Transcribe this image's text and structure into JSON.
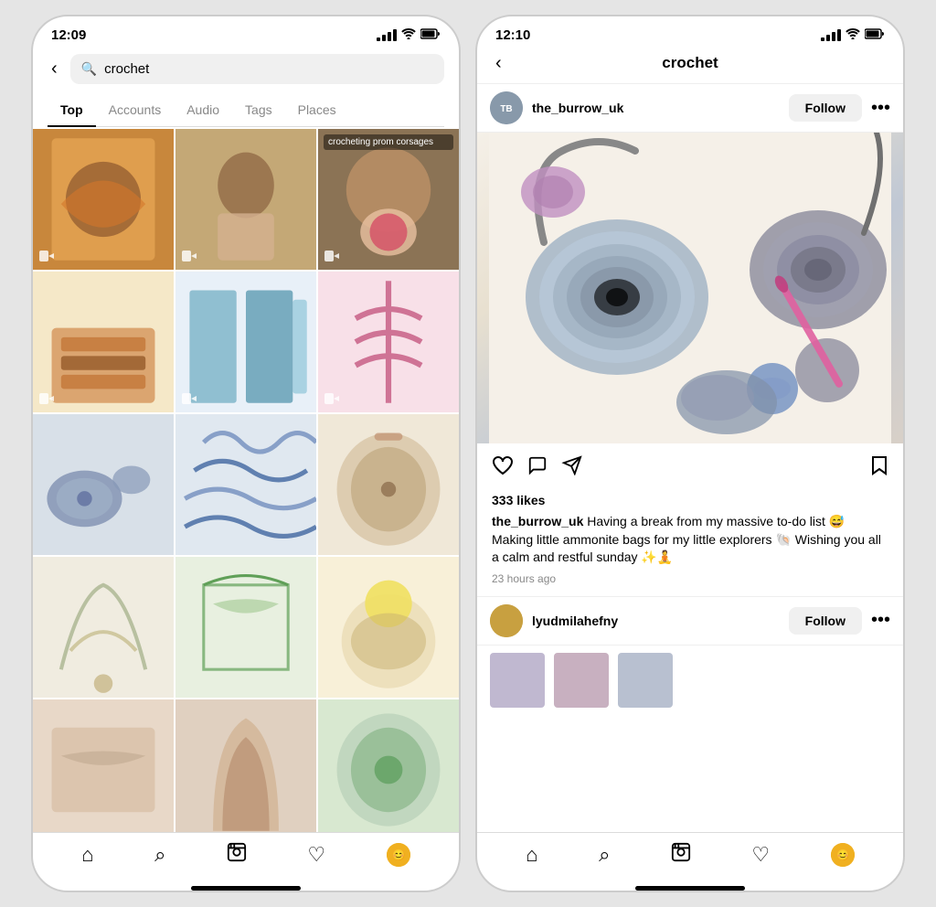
{
  "left_phone": {
    "status": {
      "time": "12:09",
      "location_icon": "▲"
    },
    "search": {
      "back_label": "‹",
      "search_placeholder": "crochet",
      "search_query": "crochet"
    },
    "tabs": [
      {
        "label": "Top",
        "active": true
      },
      {
        "label": "Accounts",
        "active": false
      },
      {
        "label": "Audio",
        "active": false
      },
      {
        "label": "Tags",
        "active": false
      },
      {
        "label": "Places",
        "active": false
      }
    ],
    "grid_items": [
      {
        "id": 1,
        "has_video": true,
        "class": "gi-1"
      },
      {
        "id": 2,
        "has_video": true,
        "class": "gi-2"
      },
      {
        "id": 3,
        "has_video": true,
        "class": "gi-3",
        "overlay": "crocheting prom corsages"
      },
      {
        "id": 4,
        "has_video": true,
        "class": "gi-4"
      },
      {
        "id": 5,
        "has_video": true,
        "class": "gi-5"
      },
      {
        "id": 6,
        "has_video": true,
        "class": "gi-6"
      },
      {
        "id": 7,
        "has_video": false,
        "class": "gi-7"
      },
      {
        "id": 8,
        "has_video": false,
        "class": "gi-8"
      },
      {
        "id": 9,
        "has_video": false,
        "class": "gi-9"
      },
      {
        "id": 10,
        "has_video": false,
        "class": "gi-10"
      },
      {
        "id": 11,
        "has_video": false,
        "class": "gi-11"
      },
      {
        "id": 12,
        "has_video": false,
        "class": "gi-12"
      },
      {
        "id": 13,
        "has_video": false,
        "class": "gi-13"
      },
      {
        "id": 14,
        "has_video": false,
        "class": "gi-14"
      },
      {
        "id": 15,
        "has_video": false,
        "class": "gi-15"
      }
    ],
    "bottom_nav": {
      "home": "🏠",
      "search": "🔍",
      "reels": "📽",
      "heart": "♡",
      "avatar": "😊"
    }
  },
  "right_phone": {
    "status": {
      "time": "12:10",
      "location_icon": "▲"
    },
    "header": {
      "back_label": "‹",
      "title": "crochet"
    },
    "post": {
      "username": "the_burrow_uk",
      "avatar_text": "TB",
      "follow_label": "Follow",
      "more_label": "•••",
      "likes": "333 likes",
      "caption_username": "the_burrow_uk",
      "caption_text": " Having a break from my massive to-do list 😅 Making little ammonite bags for my little explorers 🐚 Wishing you all a calm and restful sunday ✨🧘",
      "timestamp": "23 hours ago"
    },
    "comment": {
      "username": "lyudmilahefny",
      "avatar_color": "#c8a040",
      "follow_label": "Follow",
      "more_label": "•••"
    },
    "bottom_nav": {
      "home": "🏠",
      "search": "🔍",
      "reels": "📽",
      "heart": "♡",
      "avatar": "😊"
    }
  }
}
